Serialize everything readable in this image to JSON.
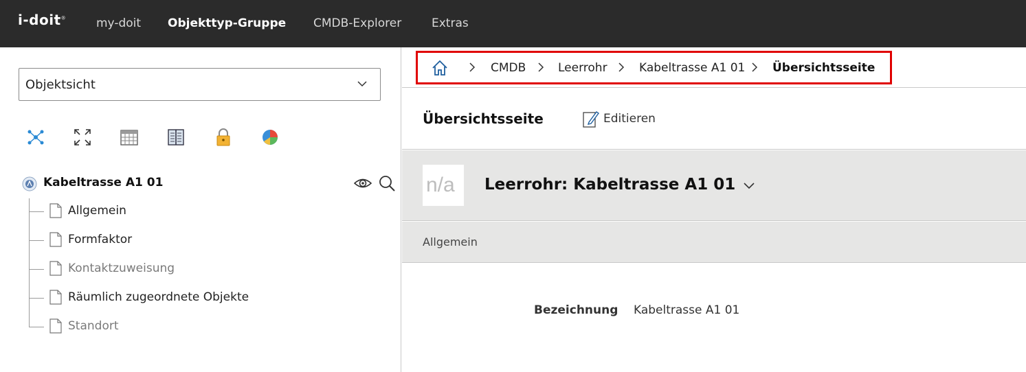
{
  "app": {
    "logo": "i-doit",
    "logo_mark": "®"
  },
  "nav": {
    "items": [
      {
        "label": "my-doit"
      },
      {
        "label": "Objekttyp-Gruppe"
      },
      {
        "label": "CMDB-Explorer"
      },
      {
        "label": "Extras"
      }
    ],
    "active": "Objekttyp-Gruppe"
  },
  "sidebar": {
    "view_select": {
      "value": "Objektsicht"
    },
    "tools": [
      "network-graph-icon",
      "expand-icon",
      "calendar-icon",
      "book-icon",
      "lock-icon",
      "pie-chart-icon"
    ],
    "tree": {
      "root": {
        "label": "Kabeltrasse A1 01"
      },
      "items": [
        {
          "label": "Allgemein",
          "dimmed": false
        },
        {
          "label": "Formfaktor",
          "dimmed": false
        },
        {
          "label": "Kontaktzuweisung",
          "dimmed": true
        },
        {
          "label": "Räumlich zugeordnete Objekte",
          "dimmed": false
        },
        {
          "label": "Standort",
          "dimmed": true
        }
      ]
    }
  },
  "breadcrumb": {
    "items": [
      {
        "label": "CMDB"
      },
      {
        "label": "Leerrohr"
      },
      {
        "label": "Kabeltrasse A1 01"
      },
      {
        "label": "Übersichtsseite"
      }
    ]
  },
  "page": {
    "heading": "Übersichtsseite",
    "edit_label": "Editieren"
  },
  "object": {
    "image_placeholder": "n/a",
    "title": "Leerrohr: Kabeltrasse A1 01"
  },
  "category": {
    "label": "Allgemein",
    "fields": [
      {
        "label": "Bezeichnung",
        "value": "Kabeltrasse A1 01"
      }
    ]
  },
  "colors": {
    "topbar": "#2b2b2b",
    "highlight": "#e00000",
    "header_bg": "#e6e6e5"
  }
}
